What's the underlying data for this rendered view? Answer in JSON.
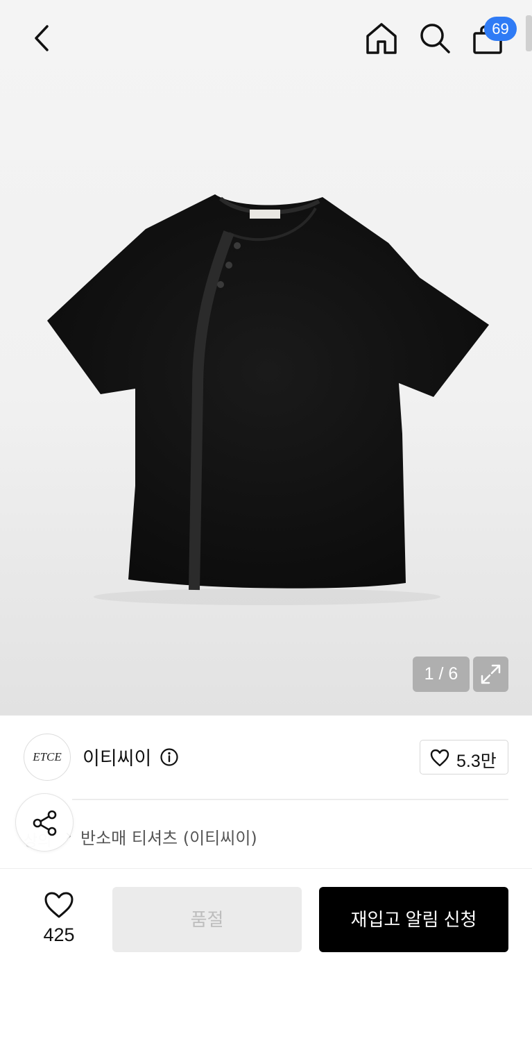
{
  "header": {
    "cart_count": "69"
  },
  "gallery": {
    "current": "1",
    "separator": "/",
    "total": "6",
    "label_tag": "ETCE"
  },
  "brand": {
    "logo_text": "ETCE",
    "name": "이티씨이",
    "likes": "5.3만"
  },
  "breadcrumb": {
    "faded": "상의",
    "separator": "›",
    "current": "반소매 티셔츠 (이티씨이)"
  },
  "actions": {
    "wish_count": "425",
    "soldout_label": "품절",
    "restock_label": "재입고 알림 신청"
  },
  "colors": {
    "badge": "#2f7bf5",
    "primary_button": "#000000",
    "disabled_button": "#ebebeb"
  }
}
